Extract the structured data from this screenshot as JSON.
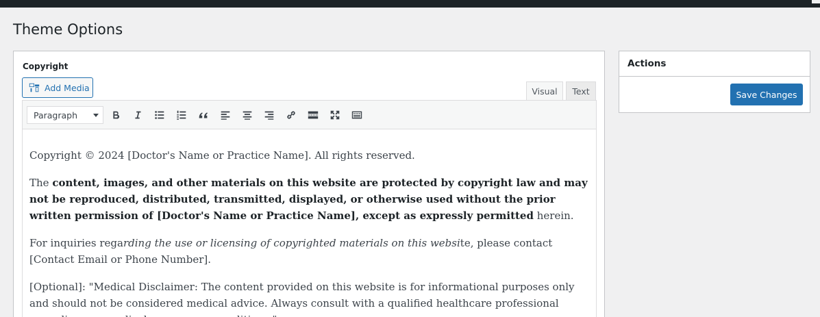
{
  "page": {
    "title": "Theme Options"
  },
  "field": {
    "label": "Copyright"
  },
  "editor": {
    "add_media_label": "Add Media",
    "tabs": {
      "visual": "Visual",
      "text": "Text"
    },
    "format_select": "Paragraph",
    "toolbar_icons": [
      "bold-icon",
      "italic-icon",
      "bulleted-list-icon",
      "numbered-list-icon",
      "blockquote-icon",
      "align-left-icon",
      "align-center-icon",
      "align-right-icon",
      "link-icon",
      "read-more-icon",
      "fullscreen-icon",
      "toolbar-toggle-icon"
    ],
    "content": {
      "p1": "Copyright © 2024 [Doctor's Name or Practice Name]. All rights reserved.",
      "p2_pre": "The ",
      "p2_bold": "content, images, and other materials on this website are protected by copyright law and may not be reproduced, distributed, transmitted, displayed, or otherwise used without the prior written permission of [Doctor's Name or Practice Name], except as expressly permitted",
      "p2_post": " herein.",
      "p3_pre": "For inquiries rega",
      "p3_italic": "rding the use or licensing of copyrighted materials on this websi",
      "p3_post": "te, please contact [Contact Email or Phone Number].",
      "p4": "[Optional]: \"Medical Disclaimer: The content provided on this website is for informational purposes only and should not be considered medical advice. Always consult with a qualified healthcare professional regarding any medical concerns or conditions.\""
    }
  },
  "actions": {
    "title": "Actions",
    "save_label": "Save Changes"
  },
  "colors": {
    "primary": "#2271b1",
    "admin_bar": "#1d2327",
    "background": "#f0f0f1"
  }
}
